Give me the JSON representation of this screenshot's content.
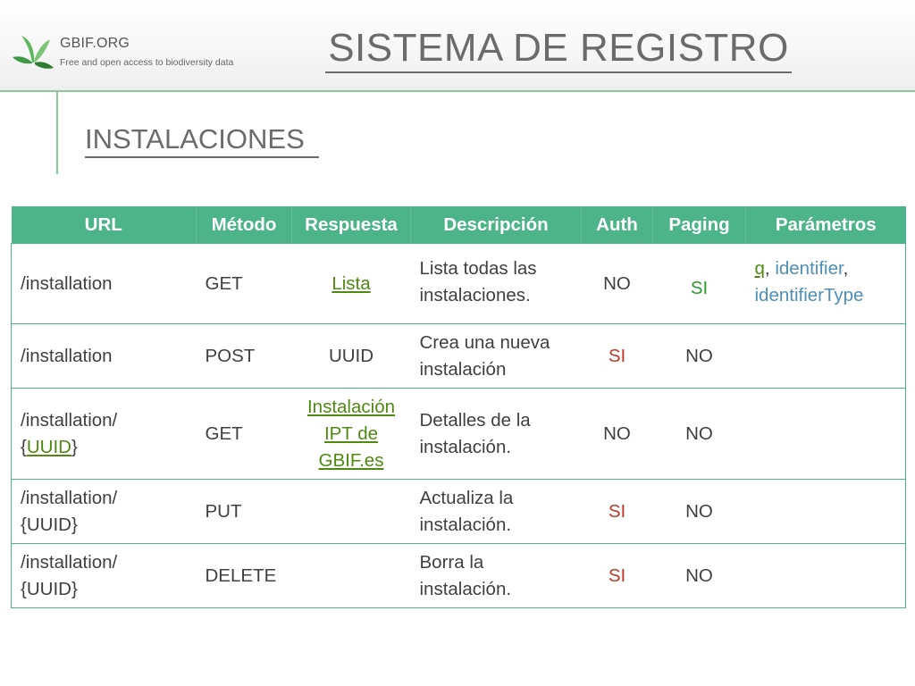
{
  "header": {
    "brand": "GBIF.ORG",
    "tagline": "Free and open access to biodiversity data",
    "logo_text": "GBIF",
    "title": "SISTEMA DE REGISTRO"
  },
  "section_title": "INSTALACIONES",
  "colors": {
    "header_green": "#4db48a",
    "accent_green": "#8cc79a",
    "red": "#c0392b",
    "link_green": "#4f8a10",
    "param_blue": "#4e8fb6"
  },
  "table": {
    "columns": [
      "URL",
      "Método",
      "Respuesta",
      "Descripción",
      "Auth",
      "Paging",
      "Parámetros"
    ],
    "rows": [
      {
        "url_1": "/installation",
        "method": "GET",
        "response": "Lista",
        "desc_1": "Lista todas las",
        "desc_2": "instalaciones.",
        "auth": "NO",
        "paging": "SI",
        "param_q": "q",
        "sep_1": ",",
        "param_identifier": "identifier",
        "sep_2": ",",
        "param_identifierType": "identifierType"
      },
      {
        "url_1": "/installation",
        "method": "POST",
        "response": "UUID",
        "desc_1": "Crea una nueva",
        "desc_2": "instalación",
        "auth": "SI",
        "paging": "NO"
      },
      {
        "url_1": "/installation/",
        "url_2_open": "{",
        "url_2_link": "UUID",
        "url_2_close": "}",
        "method": "GET",
        "response_1": "Instalación",
        "response_2": "IPT de",
        "response_3": "GBIF.es",
        "desc_1": "Detalles de la",
        "desc_2": "instalación.",
        "auth": "NO",
        "paging": "NO"
      },
      {
        "url_1": "/installation/",
        "url_2": "{UUID}",
        "method": "PUT",
        "desc_1": "Actualiza la",
        "desc_2": "instalación.",
        "auth": "SI",
        "paging": "NO"
      },
      {
        "url_1": "/installation/",
        "url_2": "{UUID}",
        "method": "DELETE",
        "desc_1": "Borra la",
        "desc_2": "instalación.",
        "auth": "SI",
        "paging": "NO"
      }
    ]
  }
}
